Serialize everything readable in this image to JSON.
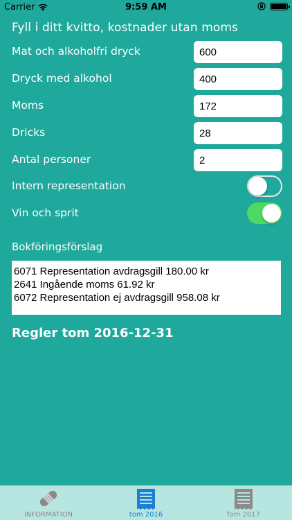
{
  "status_bar": {
    "carrier": "Carrier",
    "time": "9:59 AM"
  },
  "form": {
    "heading": "Fyll i ditt kvitto, kostnader utan moms",
    "fields": [
      {
        "label": "Mat och alkoholfri dryck",
        "value": "600"
      },
      {
        "label": "Dryck med alkohol",
        "value": "400"
      },
      {
        "label": "Moms",
        "value": "172"
      },
      {
        "label": "Dricks",
        "value": "28"
      },
      {
        "label": "Antal personer",
        "value": "2"
      }
    ],
    "toggles": [
      {
        "label": "Intern representation",
        "state": "off"
      },
      {
        "label": "Vin och sprit",
        "state": "on"
      }
    ]
  },
  "suggestion": {
    "label": "Bokföringsförslag",
    "lines": [
      "6071 Representation avdragsgill 180.00 kr",
      "2641 Ingående moms 61.92 kr",
      "6072 Representation ej avdragsgill 958.08 kr"
    ]
  },
  "rules_text": "Regler tom 2016-12-31",
  "tabbar": {
    "items": [
      {
        "label": "INFORMATION",
        "icon": "bandage-icon",
        "selected": false
      },
      {
        "label": "tom 2016",
        "icon": "receipt-icon",
        "selected": true
      },
      {
        "label": "fom 2017",
        "icon": "receipt-icon",
        "selected": false
      }
    ]
  },
  "colors": {
    "background": "#1fa89c",
    "switch_on": "#4cd964",
    "tab_selected": "#1a7fd6",
    "tabbar_bg": "#b7e6e0"
  }
}
